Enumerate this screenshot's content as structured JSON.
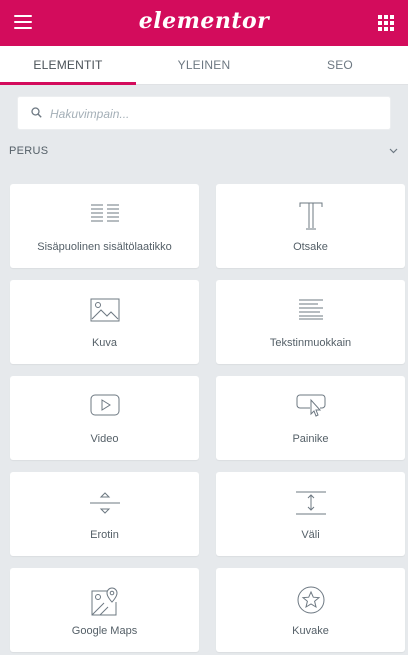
{
  "header": {
    "logo": "elementor"
  },
  "tabs": [
    {
      "label": "ELEMENTIT",
      "active": true
    },
    {
      "label": "YLEINEN",
      "active": false
    },
    {
      "label": "SEO",
      "active": false
    }
  ],
  "search": {
    "placeholder": "Hakuvimpain..."
  },
  "section": {
    "title": "PERUS"
  },
  "widgets": [
    {
      "label": "Sisäpuolinen sisältölaatikko",
      "icon": "inner-section-icon"
    },
    {
      "label": "Otsake",
      "icon": "heading-icon"
    },
    {
      "label": "Kuva",
      "icon": "image-icon"
    },
    {
      "label": "Tekstinmuokkain",
      "icon": "text-editor-icon"
    },
    {
      "label": "Video",
      "icon": "video-icon"
    },
    {
      "label": "Painike",
      "icon": "button-icon"
    },
    {
      "label": "Erotin",
      "icon": "divider-icon"
    },
    {
      "label": "Väli",
      "icon": "spacer-icon"
    },
    {
      "label": "Google Maps",
      "icon": "google-maps-icon"
    },
    {
      "label": "Kuvake",
      "icon": "star-icon"
    }
  ],
  "colors": {
    "accent": "#d30c5c",
    "panel_bg": "#e6e9ec",
    "text": "#556068"
  }
}
